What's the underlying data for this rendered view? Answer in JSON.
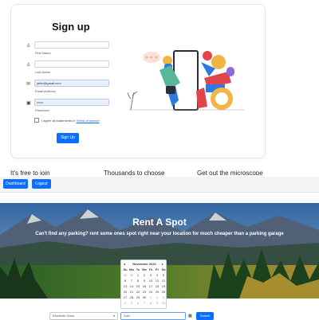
{
  "signup": {
    "title": "Sign up",
    "fields": {
      "first_name": {
        "label": "First Name",
        "value": ""
      },
      "last_name": {
        "label": "Last Name",
        "value": ""
      },
      "email": {
        "label": "Email Address",
        "value": "jarlie@gmail.com"
      },
      "password": {
        "label": "Password",
        "value": "••••••"
      }
    },
    "terms_prefix": "I agree all statements in",
    "terms_link": "Terms of service",
    "submit_label": "Sign Up"
  },
  "features": [
    {
      "heading": "It's free to join"
    },
    {
      "heading": "Thousands to choose"
    },
    {
      "heading": "Get out the microscope"
    }
  ],
  "nav": {
    "dashboard_label": "Dashboard",
    "logout_label": "Logout"
  },
  "hero": {
    "title": "Rent A Spot",
    "subtitle": "Can't find any parking? rent some ones spot right near your location for much cheaper than a parking garage"
  },
  "calendar": {
    "month_label": "November 2022",
    "prev": "◂",
    "next": "▸",
    "weekdays": [
      "Su",
      "Mo",
      "Tu",
      "We",
      "Th",
      "Fr",
      "Sa"
    ],
    "days": [
      "30",
      "31",
      "1",
      "2",
      "3",
      "4",
      "5",
      "6",
      "7",
      "8",
      "9",
      "10",
      "11",
      "12",
      "13",
      "14",
      "15",
      "16",
      "17",
      "18",
      "19",
      "20",
      "21",
      "22",
      "23",
      "24",
      "25",
      "26",
      "27",
      "28",
      "29",
      "30",
      "1",
      "2",
      "3",
      "4",
      "5",
      "6",
      "7",
      "8",
      "9",
      "10"
    ]
  },
  "search": {
    "user_selected": "Elizabeth Doan",
    "date_placeholder": "Date",
    "button_label": "Search"
  },
  "colors": {
    "primary": "#0d6efd",
    "input_filled": "#e8f0fe"
  }
}
